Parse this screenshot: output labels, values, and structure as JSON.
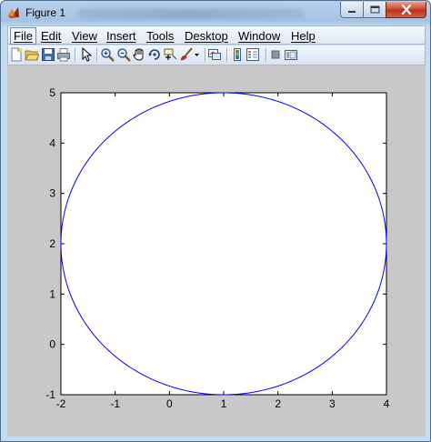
{
  "window": {
    "title": "Figure 1",
    "icon": "matlab-icon"
  },
  "controls": {
    "minimize_icon": "minimize-icon",
    "maximize_icon": "maximize-icon",
    "close_icon": "close-icon"
  },
  "menu": {
    "items": [
      {
        "label": "File",
        "name": "menu-file",
        "active": true
      },
      {
        "label": "Edit",
        "name": "menu-edit"
      },
      {
        "label": "View",
        "name": "menu-view"
      },
      {
        "label": "Insert",
        "name": "menu-insert"
      },
      {
        "label": "Tools",
        "name": "menu-tools"
      },
      {
        "label": "Desktop",
        "name": "menu-desktop"
      },
      {
        "label": "Window",
        "name": "menu-window"
      },
      {
        "label": "Help",
        "name": "menu-help"
      }
    ]
  },
  "toolbar": {
    "buttons": [
      "new-figure-icon",
      "open-file-icon",
      "save-icon",
      "print-icon",
      "edit-plot-arrow-icon",
      "zoom-in-icon",
      "zoom-out-icon",
      "pan-hand-icon",
      "rotate-3d-icon",
      "data-cursor-icon",
      "brush-icon",
      "brush-dropdown-icon",
      "link-plot-icon",
      "insert-colorbar-icon",
      "insert-legend-icon",
      "hide-plot-tools-icon",
      "show-plot-tools-icon"
    ]
  },
  "colors": {
    "curve": "#0000ff",
    "axes_background": "#ffffff",
    "figure_background": "#c8c8c8"
  },
  "chart_data": {
    "type": "line",
    "title": "",
    "xlabel": "",
    "ylabel": "",
    "xlim": [
      -2,
      4
    ],
    "ylim": [
      -1,
      5
    ],
    "xticks": [
      -2,
      -1,
      0,
      1,
      2,
      3,
      4
    ],
    "yticks": [
      -1,
      0,
      1,
      2,
      3,
      4,
      5
    ],
    "grid": false,
    "series": [
      {
        "shape": "circle",
        "center": [
          1,
          2
        ],
        "radius": 3,
        "color": "#0000ff"
      }
    ]
  }
}
